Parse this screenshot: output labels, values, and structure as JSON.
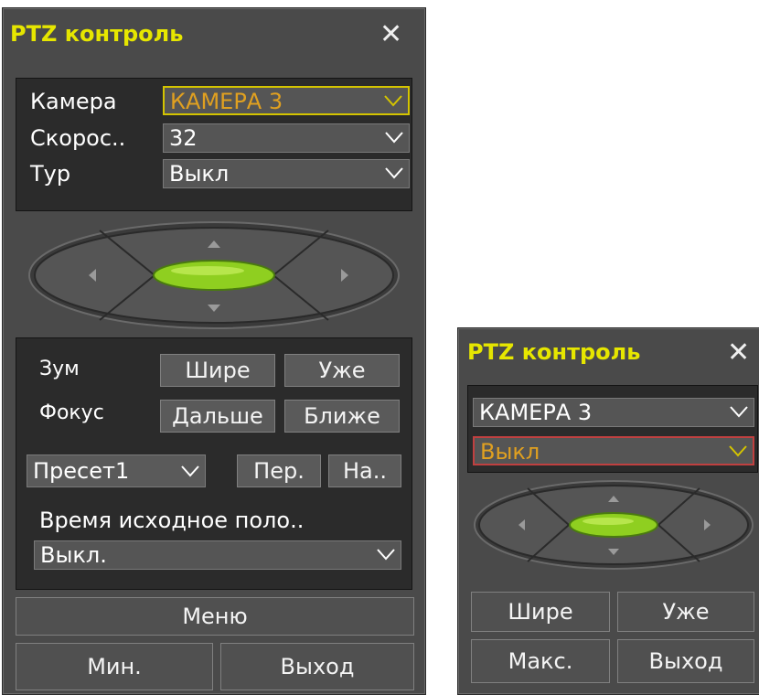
{
  "large_panel": {
    "title": "PTZ контроль",
    "close_glyph": "✕",
    "camera_label": "Камера",
    "camera_value": "КАМЕРА 3",
    "speed_label": "Скорос..",
    "speed_value": "32",
    "tour_label": "Тур",
    "tour_value": "Выкл",
    "zoom_label": "Зум",
    "focus_label": "Фокус",
    "wider_btn": "Шире",
    "narrower_btn": "Уже",
    "far_btn": "Дальше",
    "near_btn": "Ближе",
    "preset_value": "Пресет1",
    "preset_go_btn": "Пер.",
    "preset_set_btn": "На..",
    "home_time_label": "Время исходное поло..",
    "home_time_value": "Выкл.",
    "menu_btn": "Меню",
    "min_btn": "Мин.",
    "exit_btn": "Выход"
  },
  "small_panel": {
    "title": "PTZ контроль",
    "close_glyph": "✕",
    "camera_value": "КАМЕРА 3",
    "tour_value": "Выкл",
    "wider_btn": "Шире",
    "narrower_btn": "Уже",
    "max_btn": "Макс.",
    "exit_btn": "Выход"
  },
  "colors": {
    "title": "#e6e600",
    "focus_text": "#e0a020",
    "focus_border": "#d4c400",
    "accent_green": "#8fcf20",
    "panel_bg": "#4a4a4a"
  }
}
